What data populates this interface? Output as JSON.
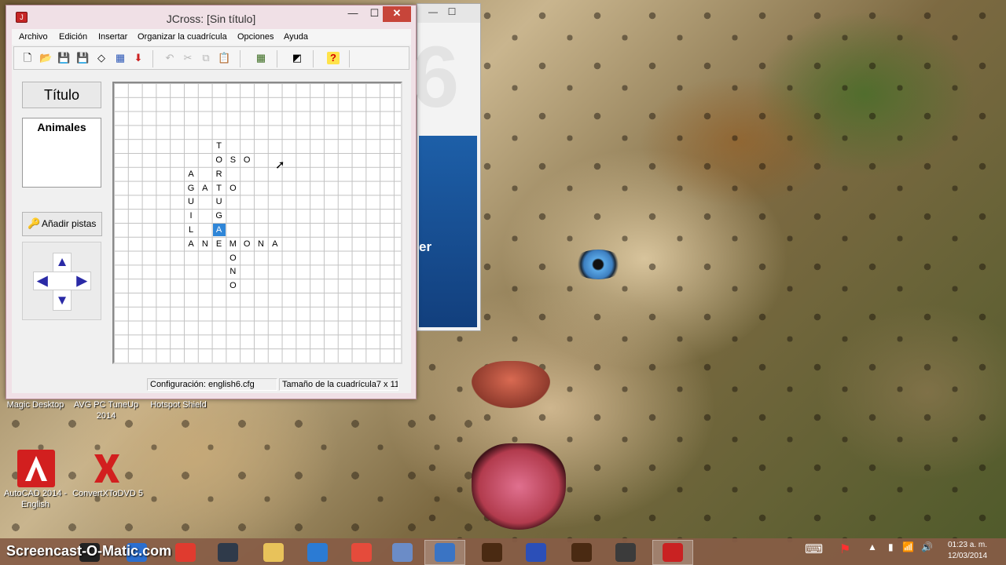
{
  "window": {
    "title": "JCross: [Sin título]",
    "minimize_glyph": "—",
    "maximize_glyph": "☐",
    "close_glyph": "✕"
  },
  "menu": [
    "Archivo",
    "Edición",
    "Insertar",
    "Organizar la cuadrícula",
    "Opciones",
    "Ayuda"
  ],
  "toolbar": {
    "icons": [
      {
        "name": "new-icon",
        "glyph": "🗋",
        "enabled": true
      },
      {
        "name": "open-icon",
        "glyph": "📂",
        "enabled": true
      },
      {
        "name": "save-icon",
        "glyph": "💾",
        "enabled": true
      },
      {
        "name": "save-as-icon",
        "glyph": "💾",
        "enabled": true
      },
      {
        "name": "eraser-icon",
        "glyph": "◇",
        "enabled": true
      },
      {
        "name": "web-export-icon",
        "glyph": "▦",
        "enabled": true
      },
      {
        "name": "hot-potatoes-icon",
        "glyph": "⬇",
        "enabled": true
      },
      {
        "name": "undo-icon",
        "glyph": "↶",
        "enabled": false
      },
      {
        "name": "cut-icon",
        "glyph": "✂",
        "enabled": false
      },
      {
        "name": "copy-icon",
        "glyph": "⧉",
        "enabled": false
      },
      {
        "name": "paste-icon",
        "glyph": "📋",
        "enabled": false
      },
      {
        "name": "grid-icon",
        "glyph": "▦",
        "enabled": true
      },
      {
        "name": "config-icon",
        "glyph": "◩",
        "enabled": true
      },
      {
        "name": "help-icon",
        "glyph": "?",
        "enabled": true
      }
    ]
  },
  "left_panel": {
    "title_button": "Título",
    "title_value": "Animales",
    "add_clues_button": "Añadir pistas",
    "key_glyph": "🔑",
    "arrows": {
      "up": "▲",
      "down": "▼",
      "left": "◀",
      "right": "▶"
    }
  },
  "grid": {
    "cells": [
      {
        "row": 4,
        "col": 7,
        "letter": "T",
        "selected": false
      },
      {
        "row": 5,
        "col": 7,
        "letter": "O",
        "selected": false
      },
      {
        "row": 5,
        "col": 8,
        "letter": "S",
        "selected": false
      },
      {
        "row": 5,
        "col": 9,
        "letter": "O",
        "selected": false
      },
      {
        "row": 6,
        "col": 5,
        "letter": "A",
        "selected": false
      },
      {
        "row": 6,
        "col": 7,
        "letter": "R",
        "selected": false
      },
      {
        "row": 7,
        "col": 5,
        "letter": "G",
        "selected": false
      },
      {
        "row": 7,
        "col": 6,
        "letter": "A",
        "selected": false
      },
      {
        "row": 7,
        "col": 7,
        "letter": "T",
        "selected": false
      },
      {
        "row": 7,
        "col": 8,
        "letter": "O",
        "selected": false
      },
      {
        "row": 8,
        "col": 5,
        "letter": "U",
        "selected": false
      },
      {
        "row": 8,
        "col": 7,
        "letter": "U",
        "selected": false
      },
      {
        "row": 9,
        "col": 5,
        "letter": "I",
        "selected": false
      },
      {
        "row": 9,
        "col": 7,
        "letter": "G",
        "selected": false
      },
      {
        "row": 10,
        "col": 5,
        "letter": "L",
        "selected": false
      },
      {
        "row": 10,
        "col": 7,
        "letter": "A",
        "selected": true
      },
      {
        "row": 11,
        "col": 5,
        "letter": "A",
        "selected": false
      },
      {
        "row": 11,
        "col": 6,
        "letter": "N",
        "selected": false
      },
      {
        "row": 11,
        "col": 7,
        "letter": "E",
        "selected": false
      },
      {
        "row": 11,
        "col": 8,
        "letter": "M",
        "selected": false
      },
      {
        "row": 11,
        "col": 9,
        "letter": "O",
        "selected": false
      },
      {
        "row": 11,
        "col": 10,
        "letter": "N",
        "selected": false
      },
      {
        "row": 11,
        "col": 11,
        "letter": "A",
        "selected": false
      },
      {
        "row": 12,
        "col": 8,
        "letter": "O",
        "selected": false
      },
      {
        "row": 13,
        "col": 8,
        "letter": "N",
        "selected": false
      },
      {
        "row": 14,
        "col": 8,
        "letter": "O",
        "selected": false
      }
    ]
  },
  "status": {
    "config": "Configuración: english6.cfg",
    "grid_size": "Tamaño de la cuadrícula7 x 11"
  },
  "background_window": {
    "minimize_glyph": "—",
    "restore_glyph": "☐",
    "visible_text": "er"
  },
  "desktop": {
    "top_labels": [
      "Magic Desktop",
      "AVG PC TuneUp 2014",
      "Hotspot Shield"
    ],
    "icons": [
      {
        "label": "AutoCAD 2014 - English",
        "color": "#d21f1f"
      },
      {
        "label": "ConvertXToDVD 5",
        "color": "#d21f1f"
      }
    ]
  },
  "taskbar": {
    "watermark": "Screencast-O-Matic.com",
    "apps": [
      {
        "name": "media-player-app",
        "color": "#222222"
      },
      {
        "name": "hp-app",
        "color": "#2b6fd0"
      },
      {
        "name": "chrome-colored-app",
        "color": "#e03b2f"
      },
      {
        "name": "camtasia-app",
        "color": "#2f3a4a"
      },
      {
        "name": "file-explorer-app",
        "color": "#e8c25a"
      },
      {
        "name": "circle-app",
        "color": "#2b7bd4"
      },
      {
        "name": "chrome-app",
        "color": "#e54b3b"
      },
      {
        "name": "avast-app",
        "color": "#6b8cc7"
      },
      {
        "name": "installer-app",
        "color": "#3a74c4"
      },
      {
        "name": "hand-app-1",
        "color": "#4a2a12"
      },
      {
        "name": "hand-app-2",
        "color": "#2b4fb8"
      },
      {
        "name": "hand-app-3",
        "color": "#4a2a12"
      },
      {
        "name": "screen-capture-app",
        "color": "#3b3b3b"
      },
      {
        "name": "jcross-app",
        "color": "#c92222"
      }
    ],
    "tray_up": "▲",
    "tray_keyboard": "⌨",
    "tray_flag": "⚑",
    "tray_battery": "▮",
    "tray_signal": "📶",
    "tray_volume": "🔊",
    "time": "01:23 a. m.",
    "date": "12/03/2014"
  }
}
